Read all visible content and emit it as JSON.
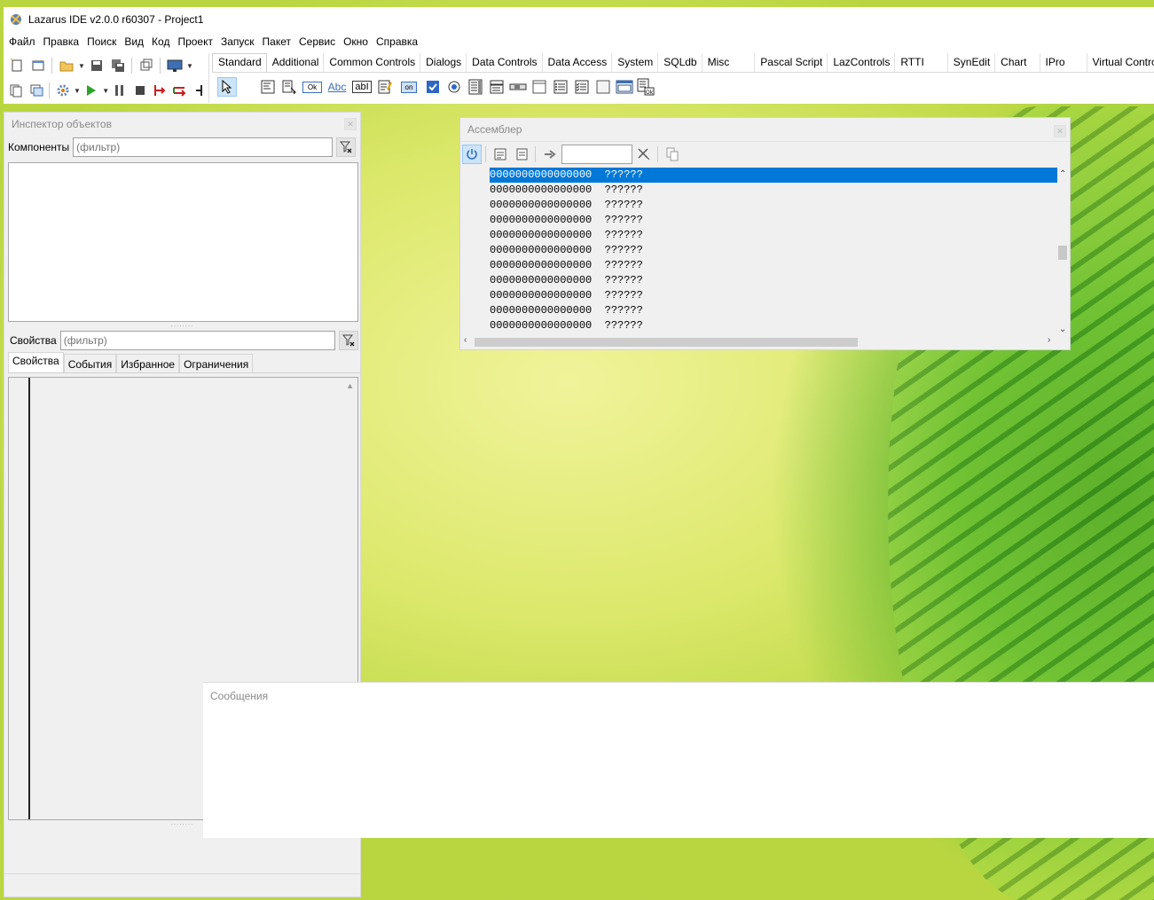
{
  "window": {
    "title": "Lazarus IDE v2.0.0 r60307 - Project1"
  },
  "menu": [
    "Файл",
    "Правка",
    "Поиск",
    "Вид",
    "Код",
    "Проект",
    "Запуск",
    "Пакет",
    "Сервис",
    "Окно",
    "Справка"
  ],
  "palette": {
    "tabs": [
      "Standard",
      "Additional",
      "Common Controls",
      "Dialogs",
      "Data Controls",
      "Data Access",
      "System",
      "SQLdb",
      "Misc",
      "Pascal Script",
      "LazControls",
      "RTTI",
      "SynEdit",
      "Chart",
      "IPro",
      "Virtual Controls"
    ],
    "active_tab": "Standard",
    "button_ok_label": "Ok",
    "label_abc": "Abc",
    "edit_abl": "abI",
    "toggle_on": "on"
  },
  "inspector": {
    "title": "Инспектор объектов",
    "components_label": "Компоненты",
    "components_filter_placeholder": "(фильтр)",
    "properties_label": "Свойства",
    "properties_filter_placeholder": "(фильтр)",
    "tabs": [
      "Свойства",
      "События",
      "Избранное",
      "Ограничения"
    ]
  },
  "assembler": {
    "title": "Ассемблер",
    "address_input": "",
    "lines": [
      "0000000000000000  ??????",
      "0000000000000000  ??????",
      "0000000000000000  ??????",
      "0000000000000000  ??????",
      "0000000000000000  ??????",
      "0000000000000000  ??????",
      "0000000000000000  ??????",
      "0000000000000000  ??????",
      "0000000000000000  ??????",
      "0000000000000000  ??????",
      "0000000000000000  ??????"
    ],
    "selected_line": 0
  },
  "messages": {
    "title": "Сообщения"
  },
  "colors": {
    "selection": "#0078d7",
    "panel_bg": "#f0f0f0"
  }
}
